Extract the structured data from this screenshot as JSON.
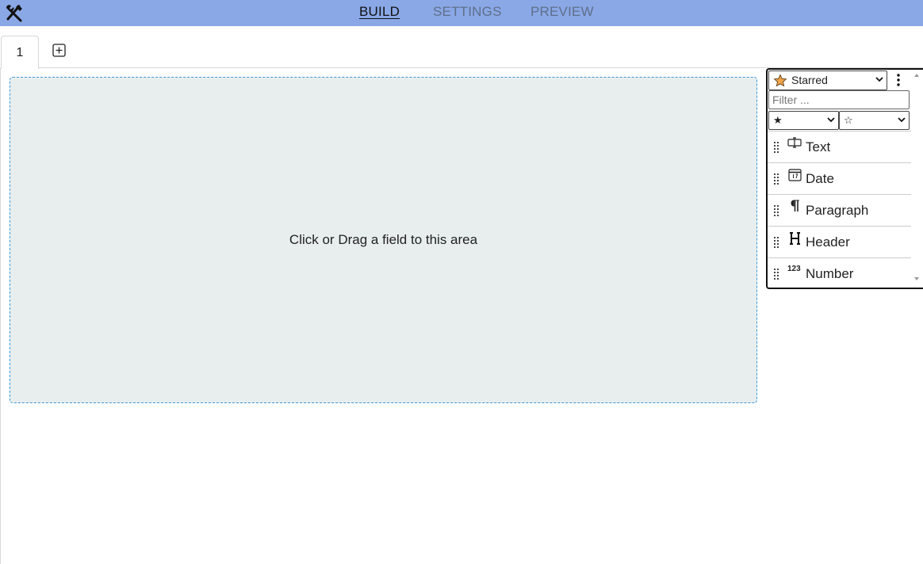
{
  "app": {
    "tools_icon": "tools-icon",
    "nav": [
      {
        "label": "BUILD",
        "active": true
      },
      {
        "label": "SETTINGS",
        "active": false
      },
      {
        "label": "PREVIEW",
        "active": false
      }
    ],
    "accent": "#8aa8e6"
  },
  "tabs": {
    "items": [
      {
        "label": "1"
      }
    ],
    "add_icon": "plus-square-icon"
  },
  "canvas": {
    "drop_text": "Click or Drag a field to this area"
  },
  "palette": {
    "category": {
      "label": "Starred",
      "icon": "star-icon"
    },
    "menu_icon": "kebab-icon",
    "filter_placeholder": "Filter ...",
    "filter_value": "",
    "sort_select_1": "★",
    "sort_select_2": "☆",
    "fields": [
      {
        "label": "Text",
        "icon": "text-field-icon"
      },
      {
        "label": "Date",
        "icon": "calendar-icon"
      },
      {
        "label": "Paragraph",
        "icon": "pilcrow-icon"
      },
      {
        "label": "Header",
        "icon": "header-icon"
      },
      {
        "label": "Number",
        "icon": "number-icon"
      }
    ]
  }
}
